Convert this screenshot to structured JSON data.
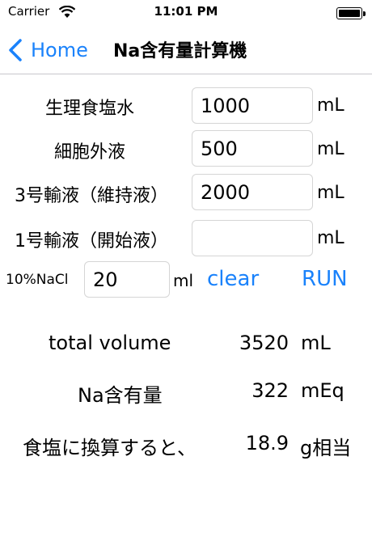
{
  "status_bar": {
    "carrier": "Carrier",
    "time": "11:01 PM"
  },
  "nav": {
    "back_label": "Home",
    "title": "Na含有量計算機"
  },
  "inputs": [
    {
      "label": "生理食塩水",
      "value": "1000",
      "unit": "mL"
    },
    {
      "label": "細胞外液",
      "value": "500",
      "unit": "mL"
    },
    {
      "label": "3号輸液（維持液）",
      "value": "2000",
      "unit": "mL"
    },
    {
      "label": "1号輸液（開始液）",
      "value": "",
      "unit": "mL"
    }
  ],
  "nacl": {
    "label": "10%NaCl",
    "value": "20",
    "unit": "ml"
  },
  "buttons": {
    "clear": "clear",
    "run": "RUN"
  },
  "results": [
    {
      "label": "total volume",
      "value": "3520",
      "unit": "mL"
    },
    {
      "label": "Na含有量",
      "value": "322",
      "unit": "mEq"
    },
    {
      "label": "食塩に換算すると、",
      "value": "18.9",
      "unit": "g相当"
    }
  ],
  "colors": {
    "accent": "#1a82fb"
  }
}
